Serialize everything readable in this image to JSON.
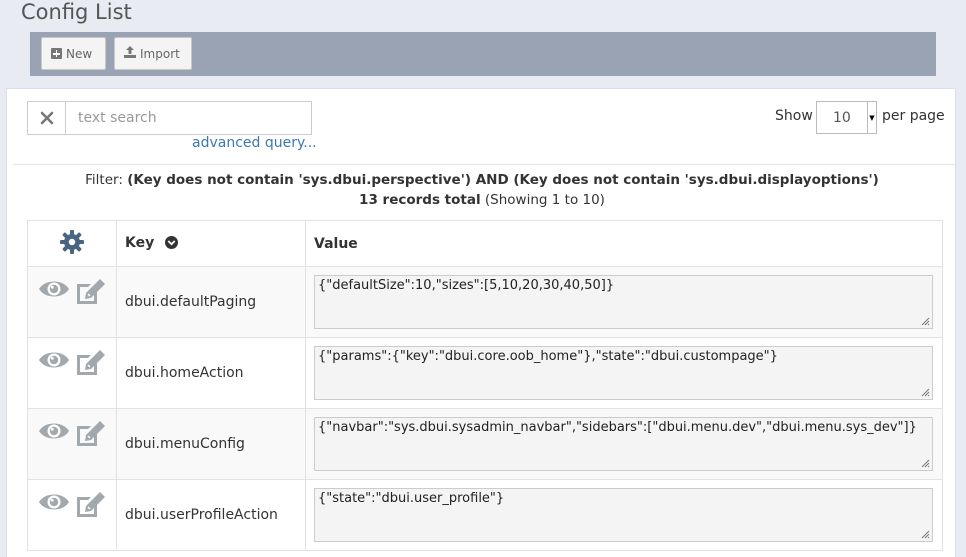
{
  "page": {
    "title": "Config List"
  },
  "toolbar": {
    "new_label": "New",
    "import_label": "Import"
  },
  "search": {
    "placeholder": "text search",
    "value": "",
    "advanced_label": "advanced query..."
  },
  "paging": {
    "show_label": "Show",
    "per_page_value": "10",
    "per_page_label": "per page"
  },
  "filter": {
    "prefix": "Filter:",
    "expression": "(Key does not contain 'sys.dbui.perspective') AND (Key does not contain 'sys.dbui.displayoptions')",
    "total_bold": "13 records total",
    "showing": "(Showing 1 to 10)"
  },
  "table": {
    "columns": {
      "key": "Key",
      "value": "Value"
    },
    "rows": [
      {
        "key": "dbui.defaultPaging",
        "value": "{\"defaultSize\":10,\"sizes\":[5,10,20,30,40,50]}"
      },
      {
        "key": "dbui.homeAction",
        "value": "{\"params\":{\"key\":\"dbui.core.oob_home\"},\"state\":\"dbui.custompage\"}"
      },
      {
        "key": "dbui.menuConfig",
        "value": "{\"navbar\":\"sys.dbui.sysadmin_navbar\",\"sidebars\":[\"dbui.menu.dev\",\"dbui.menu.sys_dev\"]}"
      },
      {
        "key": "dbui.userProfileAction",
        "value": "{\"state\":\"dbui.user_profile\"}"
      }
    ]
  },
  "icons": {
    "new": "plus-square-icon",
    "import": "upload-icon",
    "clear": "close-icon",
    "settings": "gear-icon",
    "sort": "chevron-circle-down-icon",
    "view": "eye-icon",
    "edit": "edit-icon"
  },
  "colors": {
    "icon_gray": "#9aa0a6",
    "link": "#3a79b0",
    "toolbar": "#9aa3b3",
    "gear": "#4a6580"
  }
}
